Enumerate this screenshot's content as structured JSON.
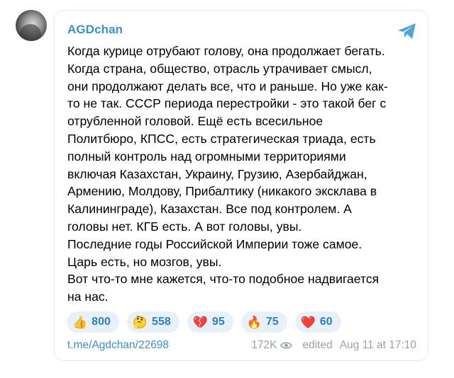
{
  "post": {
    "channel_name": "AGDchan",
    "text": "Когда курице отрубают голову, она продолжает бегать.\nКогда страна, общество, отрасль утрачивает смысл,\nони продолжают делать все, что и раньше. Но уже как-\nто не так. СССР периода перестройки - это такой бег с\nотрубленной головой. Ещё есть всесильное\nПолитбюро, КПСС, есть стратегическая триада, есть\nполный контроль над огромными территориями\nвключая Казахстан, Украину, Грузию, Азербайджан,\nАрмению, Молдову, Прибалтику (никакого эксклава в\nКалининграде), Казахстан. Все под контролем. А\nголовы нет. КГБ есть. А вот головы, увы.\nПоследние годы Российской Империи тоже самое.\nЦарь есть, но мозгов, увы.\nВот что-то мне кажется, что-то подобное надвигается\nна нас.",
    "reactions": [
      {
        "emoji": "👍",
        "count": "800",
        "icon": "thumbs-up-icon"
      },
      {
        "emoji": "🤔",
        "count": "558",
        "icon": "thinking-face-icon"
      },
      {
        "emoji": "💔",
        "count": "95",
        "icon": "broken-heart-icon"
      },
      {
        "emoji": "🔥",
        "count": "75",
        "icon": "fire-icon"
      },
      {
        "emoji": "❤️",
        "count": "60",
        "icon": "red-heart-icon"
      }
    ],
    "link": "t.me/Agdchan/22698",
    "views": "172K",
    "edited_label": "edited",
    "date": "Aug 11 at 17:10"
  },
  "colors": {
    "accent": "#3a90cf",
    "reaction_bg": "#e8f1fa",
    "meta": "#9aa3ab",
    "share_icon": "#4ea4de"
  }
}
